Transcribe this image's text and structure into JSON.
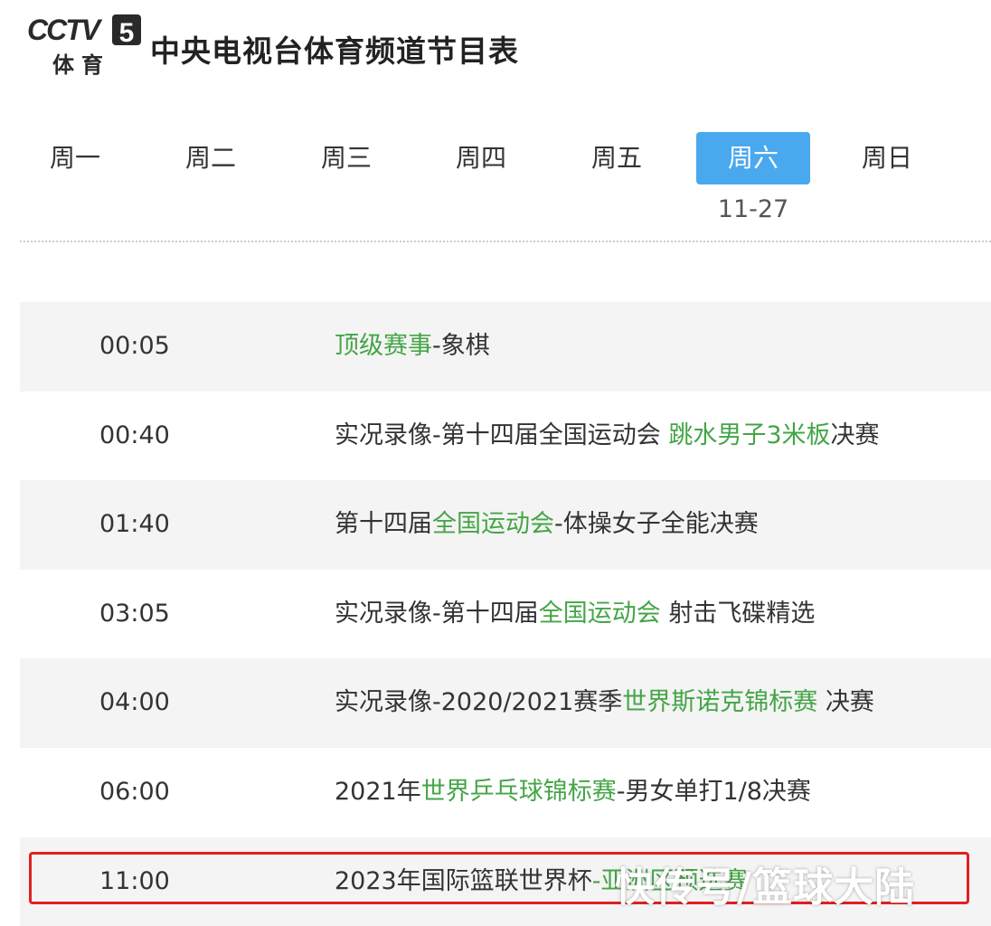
{
  "header": {
    "logo": {
      "brand": "CCTV",
      "number": "5",
      "subtitle": "体育"
    },
    "title": "中央电视台体育频道节目表"
  },
  "day_tabs": [
    {
      "label": "周一"
    },
    {
      "label": "周二"
    },
    {
      "label": "周三"
    },
    {
      "label": "周四"
    },
    {
      "label": "周五"
    },
    {
      "label": "周六",
      "active": true,
      "date": "11-27"
    },
    {
      "label": "周日"
    }
  ],
  "colors": {
    "accent": "#4aa8ee",
    "link_green": "#44a547",
    "highlight_border": "#e02020"
  },
  "schedule": [
    {
      "time": "00:05",
      "parts": [
        {
          "text": "顶级赛事",
          "hl": true
        },
        {
          "text": "-象棋"
        }
      ]
    },
    {
      "time": "00:40",
      "parts": [
        {
          "text": "实况录像-第十四届全国运动会 "
        },
        {
          "text": "跳水男子3米板",
          "hl": true
        },
        {
          "text": "决赛"
        }
      ]
    },
    {
      "time": "01:40",
      "parts": [
        {
          "text": "第十四届"
        },
        {
          "text": "全国运动会",
          "hl": true
        },
        {
          "text": "-体操女子全能决赛"
        }
      ]
    },
    {
      "time": "03:05",
      "parts": [
        {
          "text": "实况录像-第十四届"
        },
        {
          "text": "全国运动会",
          "hl": true
        },
        {
          "text": " 射击飞碟精选"
        }
      ]
    },
    {
      "time": "04:00",
      "parts": [
        {
          "text": "实况录像-2020/2021赛季"
        },
        {
          "text": "世界斯诺克锦标赛",
          "hl": true
        },
        {
          "text": " 决赛"
        }
      ]
    },
    {
      "time": "06:00",
      "parts": [
        {
          "text": "2021年"
        },
        {
          "text": "世界乒乓球锦标赛",
          "hl": true
        },
        {
          "text": "-男女单打1/8决赛"
        }
      ]
    },
    {
      "time": "11:00",
      "parts": [
        {
          "text": "2023年国际篮联世界杯"
        },
        {
          "text": "-亚洲区预选赛",
          "hl": true
        }
      ]
    }
  ],
  "watermark": "快传号/篮球大陆"
}
